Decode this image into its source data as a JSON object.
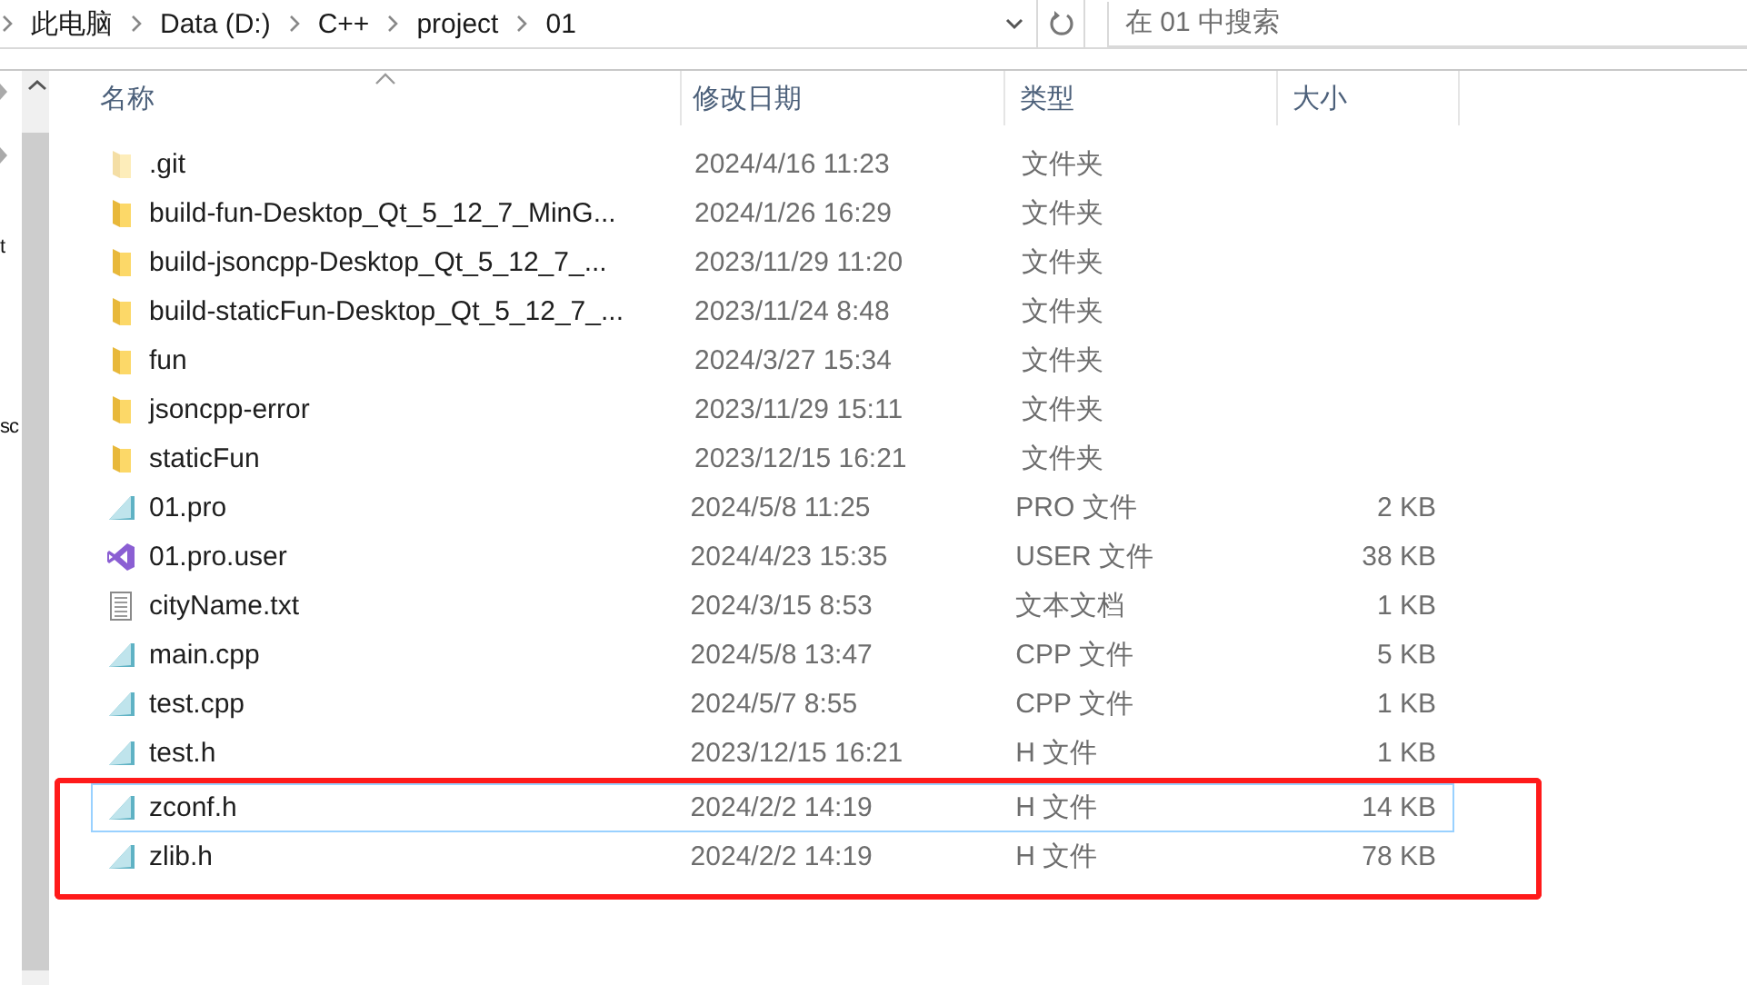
{
  "address_bar": {
    "breadcrumbs": [
      "此电脑",
      "Data (D:)",
      "C++",
      "project",
      "01"
    ]
  },
  "search": {
    "placeholder": "在 01 中搜索"
  },
  "nav_pane": {
    "fragments": [
      "t",
      "sc"
    ]
  },
  "file_list": {
    "columns": [
      {
        "label": "名称",
        "sorted": true
      },
      {
        "label": "修改日期",
        "sorted": false
      },
      {
        "label": "类型",
        "sorted": false
      },
      {
        "label": "大小",
        "sorted": false
      }
    ],
    "rows": [
      {
        "kind": "hidden-folder",
        "name": ".git",
        "date": "2024/4/16 11:23",
        "type": "文件夹",
        "focused": false,
        "annotated": false
      },
      {
        "kind": "folder",
        "name": "build-fun-Desktop_Qt_5_12_7_MinG...",
        "date": "2024/1/26 16:29",
        "type": "文件夹",
        "focused": false,
        "annotated": false
      },
      {
        "kind": "folder",
        "name": "build-jsoncpp-Desktop_Qt_5_12_7_...",
        "date": "2023/11/29 11:20",
        "type": "文件夹",
        "focused": false,
        "annotated": false
      },
      {
        "kind": "folder",
        "name": "build-staticFun-Desktop_Qt_5_12_7_...",
        "date": "2023/11/24 8:48",
        "type": "文件夹",
        "focused": false,
        "annotated": false
      },
      {
        "kind": "folder",
        "name": "fun",
        "date": "2024/3/27 15:34",
        "type": "文件夹",
        "focused": false,
        "annotated": false
      },
      {
        "kind": "folder",
        "name": "jsoncpp-error",
        "date": "2023/11/29 15:11",
        "type": "文件夹",
        "focused": false,
        "annotated": false
      },
      {
        "kind": "folder",
        "name": "staticFun",
        "date": "2023/12/15 16:21",
        "type": "文件夹",
        "focused": false,
        "annotated": false
      },
      {
        "kind": "qt-file",
        "name": "01.pro",
        "date": "2024/5/8 11:25",
        "type": "PRO 文件",
        "size": "2 KB",
        "focused": false,
        "annotated": false
      },
      {
        "kind": "vs-file",
        "name": "01.pro.user",
        "date": "2024/4/23 15:35",
        "type": "USER 文件",
        "size": "38 KB",
        "focused": false,
        "annotated": false
      },
      {
        "kind": "text-file",
        "name": "cityName.txt",
        "date": "2024/3/15 8:53",
        "type": "文本文档",
        "size": "1 KB",
        "focused": false,
        "annotated": false
      },
      {
        "kind": "qt-file",
        "name": "main.cpp",
        "date": "2024/5/8 13:47",
        "type": "CPP 文件",
        "size": "5 KB",
        "focused": false,
        "annotated": false
      },
      {
        "kind": "qt-file",
        "name": "test.cpp",
        "date": "2024/5/7 8:55",
        "type": "CPP 文件",
        "size": "1 KB",
        "focused": false,
        "annotated": false
      },
      {
        "kind": "qt-file",
        "name": "test.h",
        "date": "2023/12/15 16:21",
        "type": "H 文件",
        "size": "1 KB",
        "focused": false,
        "annotated": false
      },
      {
        "kind": "qt-file",
        "name": "zconf.h",
        "date": "2024/2/2 14:19",
        "type": "H 文件",
        "size": "14 KB",
        "focused": true,
        "annotated": true
      },
      {
        "kind": "qt-file",
        "name": "zlib.h",
        "date": "2024/2/2 14:19",
        "type": "H 文件",
        "size": "78 KB",
        "focused": false,
        "annotated": true
      }
    ]
  }
}
